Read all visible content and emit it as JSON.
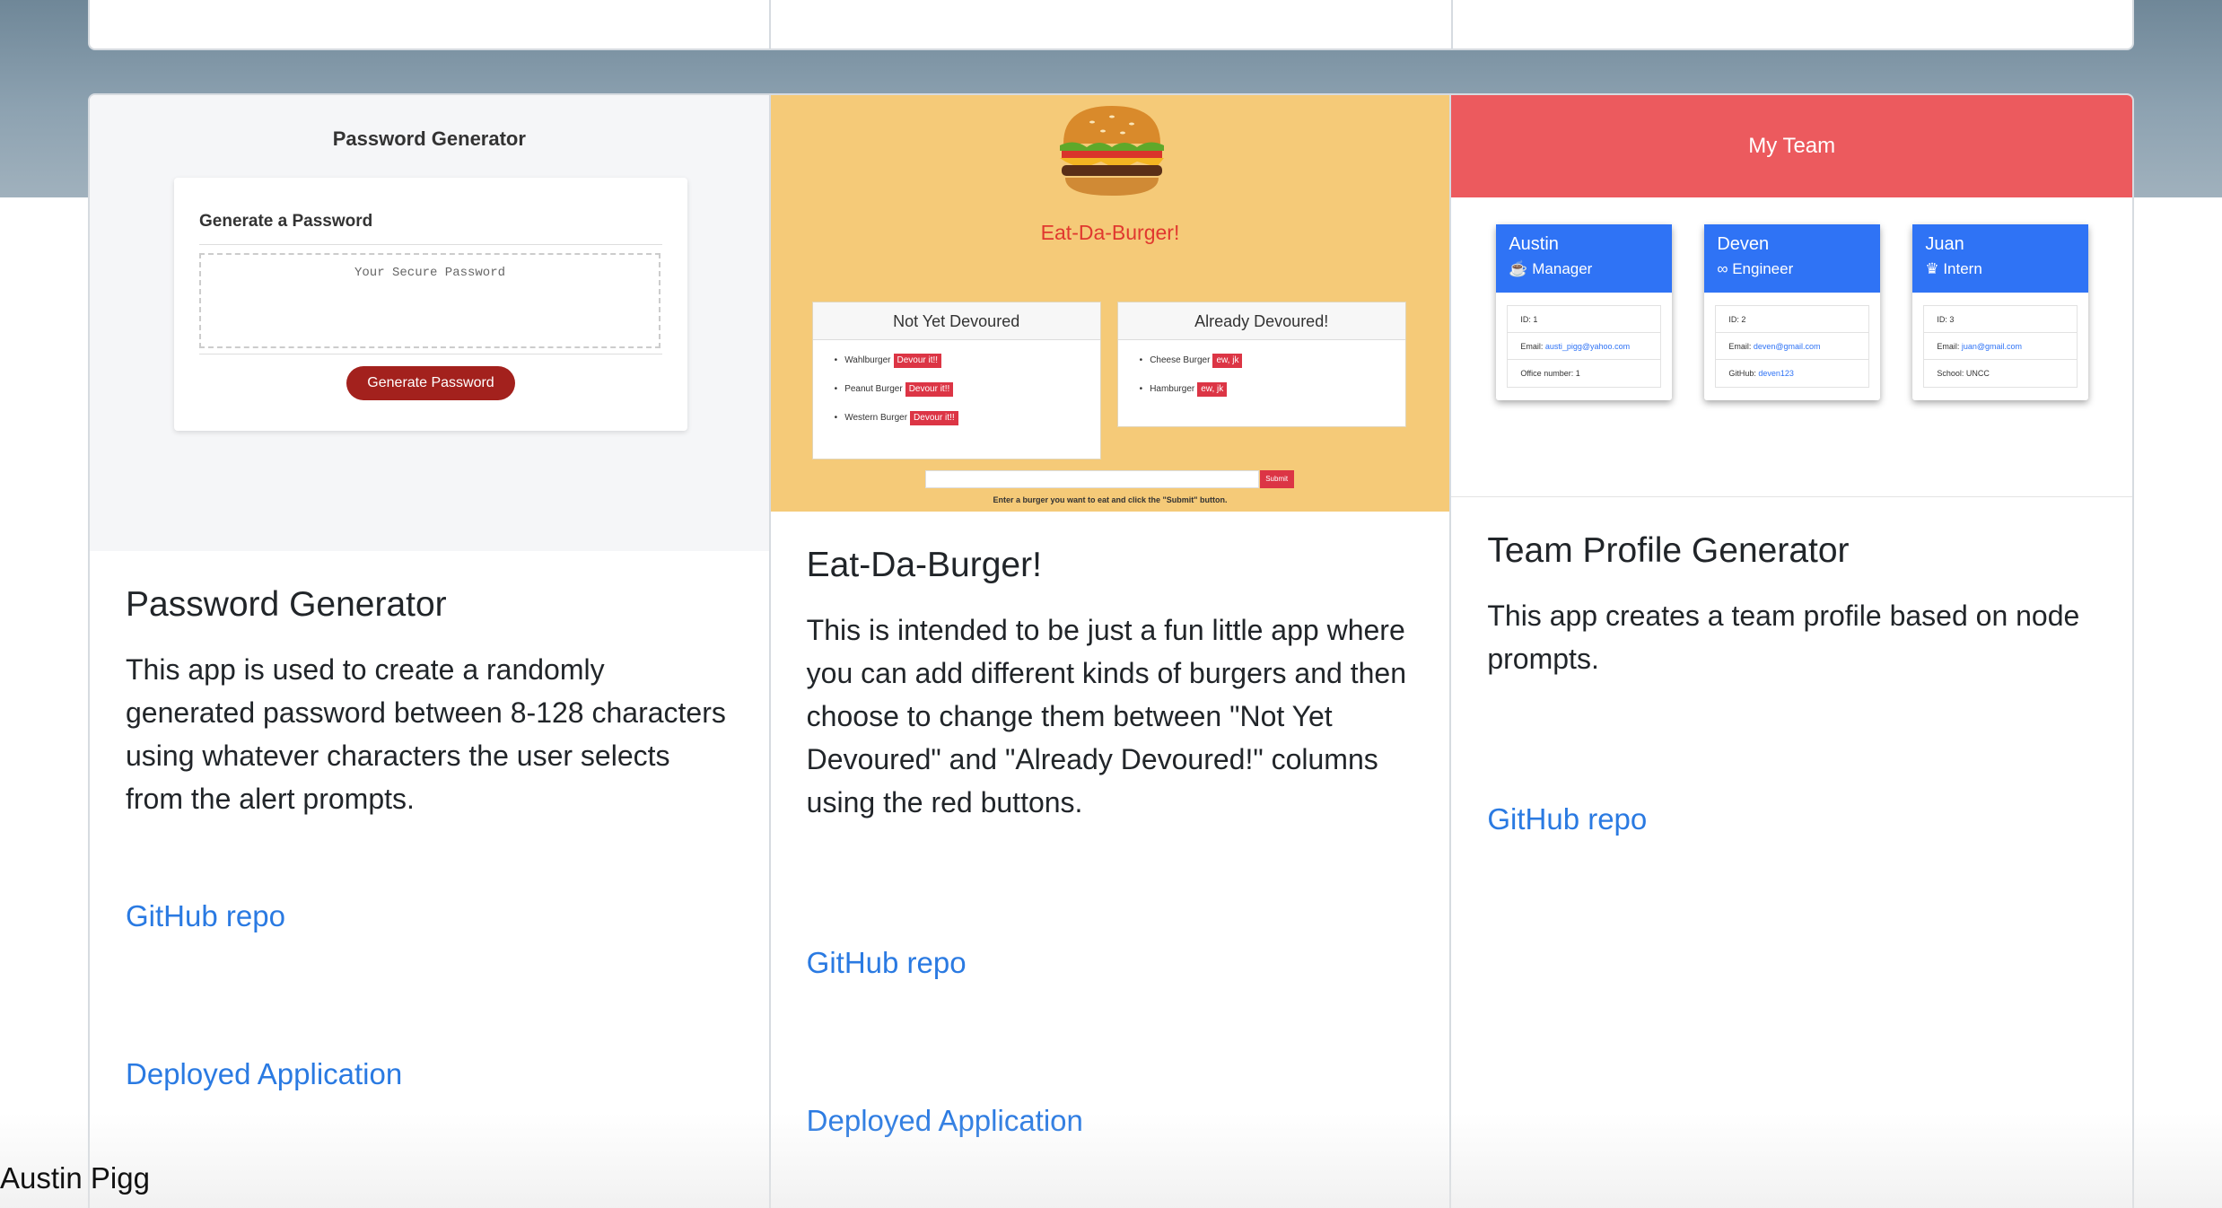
{
  "footer": {
    "author": "Austin Pigg"
  },
  "projects": [
    {
      "title": "Password Generator",
      "description": "This app is used to create a randomly generated password between 8-128 characters using whatever characters the user selects from the alert prompts.",
      "github_label": "GitHub repo",
      "deployed_label": "Deployed Application",
      "preview": {
        "title": "Password Generator",
        "card_heading": "Generate a Password",
        "placeholder": "Your Secure Password",
        "button": "Generate Password"
      }
    },
    {
      "title": "Eat-Da-Burger!",
      "description": "This is intended to be just a fun little app where you can add different kinds of burgers and then choose to change them between \"Not Yet Devoured\" and \"Already Devoured!\" columns using the red buttons.",
      "github_label": "GitHub repo",
      "deployed_label": "Deployed Application",
      "preview": {
        "title": "Eat-Da-Burger!",
        "left_heading": "Not Yet Devoured",
        "right_heading": "Already Devoured!",
        "left_items": [
          "Wahlburger",
          "Peanut Burger",
          "Western Burger"
        ],
        "left_button": "Devour it!!",
        "right_items": [
          "Cheese Burger",
          "Hamburger"
        ],
        "right_button": "ew, jk",
        "submit": "Submit",
        "hint": "Enter a burger you want to eat and click the \"Submit\" button."
      }
    },
    {
      "title": "Team Profile Generator",
      "description": "This app creates a team profile based on node prompts.",
      "github_label": "GitHub repo",
      "preview": {
        "header": "My Team",
        "members": [
          {
            "name": "Austin",
            "role": "Manager",
            "icon": "coffee-icon",
            "id": "ID: 1",
            "email_label": "Email:",
            "email": "austi_pigg@yahoo.com",
            "extra_label": "Office number: 1",
            "extra_link": ""
          },
          {
            "name": "Deven",
            "role": "Engineer",
            "icon": "glasses-icon",
            "id": "ID: 2",
            "email_label": "Email:",
            "email": "deven@gmail.com",
            "extra_label": "GitHub:",
            "extra_link": "deven123"
          },
          {
            "name": "Juan",
            "role": "Intern",
            "icon": "graduate-icon",
            "id": "ID: 3",
            "email_label": "Email:",
            "email": "juan@gmail.com",
            "extra_label": "School: UNCC",
            "extra_link": ""
          }
        ]
      }
    }
  ]
}
